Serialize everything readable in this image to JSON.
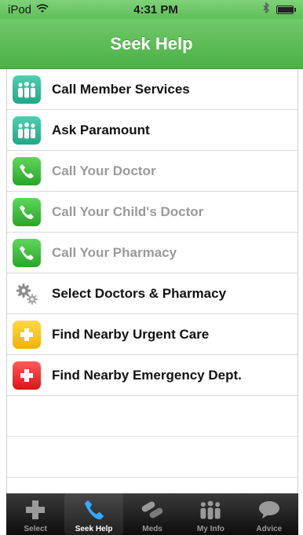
{
  "status_bar": {
    "carrier": "iPod",
    "time": "4:31 PM"
  },
  "nav": {
    "title": "Seek Help"
  },
  "list": {
    "items": [
      {
        "label": "Call Member Services",
        "icon": "people-icon",
        "color": "#1fa785",
        "enabled": true
      },
      {
        "label": "Ask Paramount",
        "icon": "people-icon",
        "color": "#1fa785",
        "enabled": true
      },
      {
        "label": "Call Your Doctor",
        "icon": "phone-icon",
        "color": "#2aa42a",
        "enabled": false
      },
      {
        "label": "Call Your Child's Doctor",
        "icon": "phone-icon",
        "color": "#2aa42a",
        "enabled": false
      },
      {
        "label": "Call Your Pharmacy",
        "icon": "phone-icon",
        "color": "#2aa42a",
        "enabled": false
      },
      {
        "label": "Select Doctors & Pharmacy",
        "icon": "gears-icon",
        "color": "#888888",
        "enabled": true
      },
      {
        "label": "Find Nearby Urgent Care",
        "icon": "plus-icon",
        "color": "#f0b400",
        "enabled": true
      },
      {
        "label": "Find Nearby Emergency Dept.",
        "icon": "plus-icon",
        "color": "#d61616",
        "enabled": true
      }
    ]
  },
  "tabbar": {
    "tabs": [
      {
        "label": "Select",
        "icon": "plus-icon",
        "active": false
      },
      {
        "label": "Seek Help",
        "icon": "phone-icon",
        "active": true
      },
      {
        "label": "Meds",
        "icon": "pills-icon",
        "active": false
      },
      {
        "label": "My Info",
        "icon": "people-icon",
        "active": false
      },
      {
        "label": "Advice",
        "icon": "speech-bubble-icon",
        "active": false
      }
    ]
  },
  "colors": {
    "header_green": "#4db047",
    "tab_active_blue": "#35a8ff"
  }
}
